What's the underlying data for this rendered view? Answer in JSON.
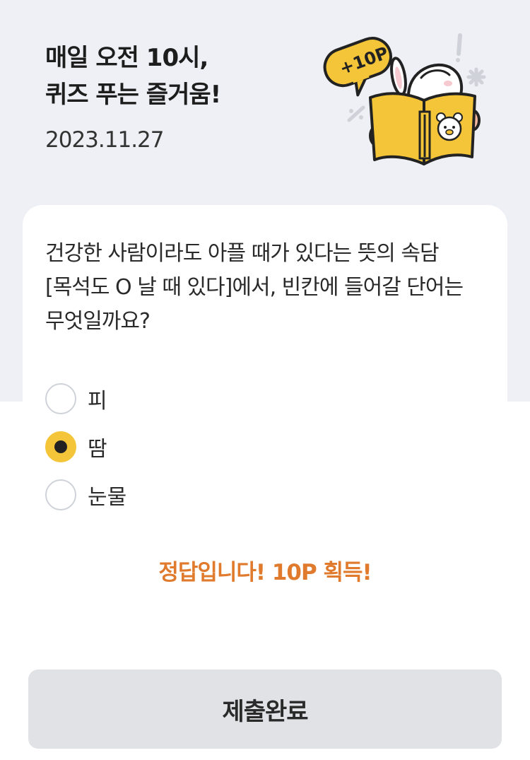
{
  "header": {
    "title_line1": "매일 오전 10시,",
    "title_line2": "퀴즈 푸는 즐거움!",
    "date": "2023.11.27"
  },
  "illustration": {
    "badge_text": "+10P",
    "icon": "rabbit-reading-book-icon"
  },
  "quiz": {
    "question_line1": "건강한 사람이라도 아플 때가 있다는 뜻의 속담",
    "question_line2": "[목석도 O 날 때 있다]에서, 빈칸에 들어갈 단어는",
    "question_line3": "무엇일까요?",
    "options": [
      {
        "label": "피",
        "selected": false
      },
      {
        "label": "땀",
        "selected": true
      },
      {
        "label": "눈물",
        "selected": false
      }
    ]
  },
  "result": {
    "message": "정답입니다! 10P 획득!"
  },
  "submit": {
    "label": "제출완료"
  },
  "colors": {
    "background_top": "#eef0f5",
    "accent_yellow": "#f4c538",
    "result_orange": "#e07a2c",
    "button_gray": "#e0e2e6"
  }
}
